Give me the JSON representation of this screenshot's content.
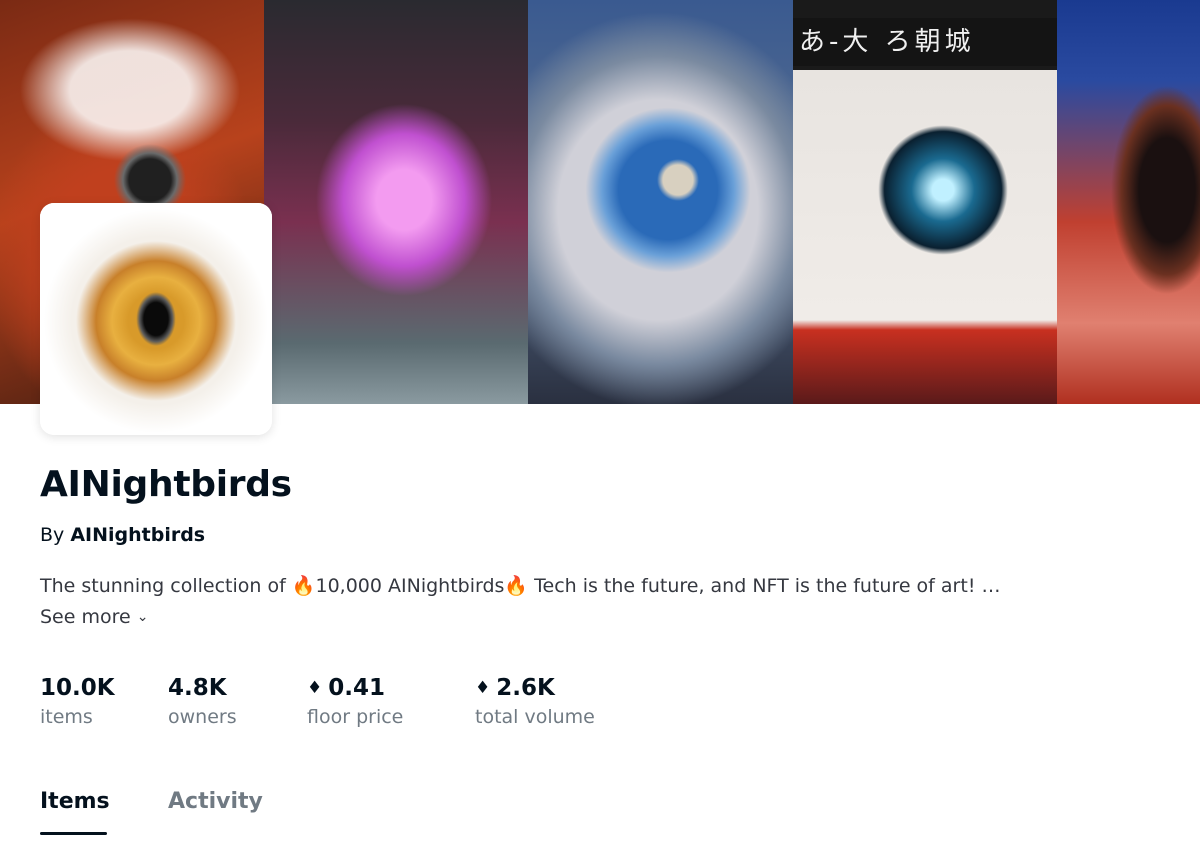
{
  "banner": {
    "sign_text": "あ-大 ろ朝城"
  },
  "collection": {
    "title": "AINightbirds",
    "by_prefix": "By",
    "creator": "AINightbirds",
    "description": "The stunning collection of 🔥10,000 AINightbirds🔥 Tech is the future, and NFT is the future of art! …",
    "see_more": "See more",
    "chevron_icon": "chevron-down-icon"
  },
  "stats": {
    "currency_icon": "ethereum-icon",
    "items": {
      "value": "10.0K",
      "label": "items"
    },
    "owners": {
      "value": "4.8K",
      "label": "owners"
    },
    "floor_price": {
      "value": "0.41",
      "label": "floor price"
    },
    "total_volume": {
      "value": "2.6K",
      "label": "total volume"
    }
  },
  "tabs": {
    "items": "Items",
    "activity": "Activity",
    "selected": "Items"
  }
}
